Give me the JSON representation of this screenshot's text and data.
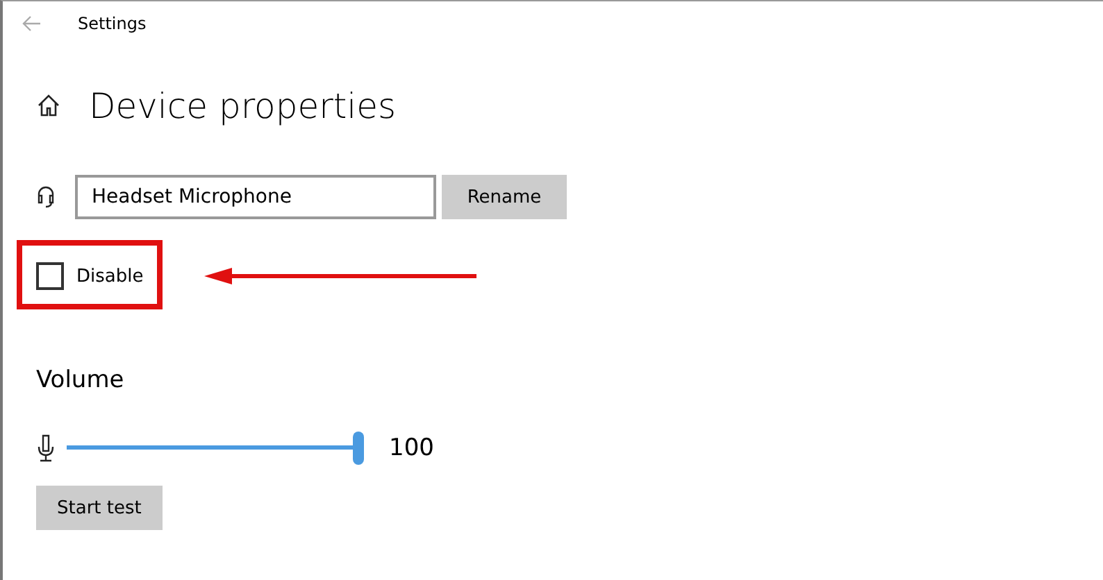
{
  "window": {
    "title": "Settings"
  },
  "heading": "Device properties",
  "device": {
    "name": "Headset Microphone",
    "rename_button": "Rename"
  },
  "disable": {
    "label": "Disable",
    "checked": false
  },
  "volume": {
    "heading": "Volume",
    "level": 1,
    "reading": "100",
    "test_button": "Start test"
  }
}
